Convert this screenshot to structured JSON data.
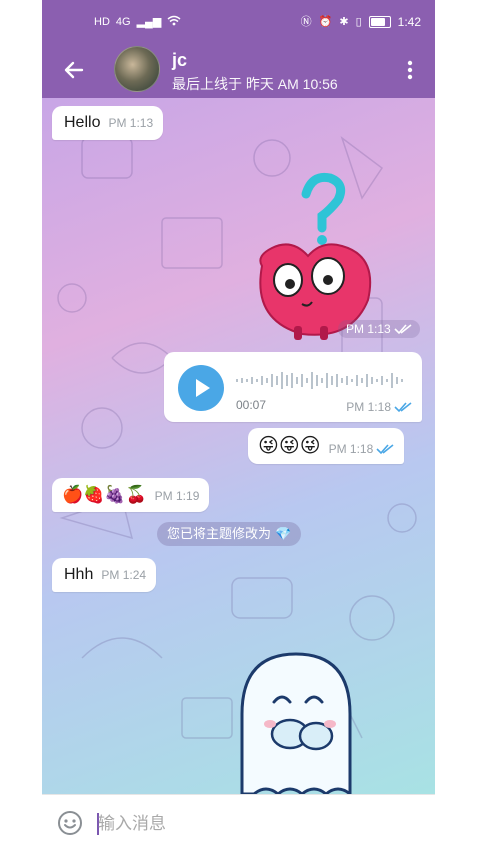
{
  "status_bar": {
    "left_icons": [
      "HD",
      "4G"
    ],
    "time": "1:42"
  },
  "header": {
    "name": "jc",
    "last_seen": "最后上线于 昨天 AM 10:56"
  },
  "messages": [
    {
      "dir": "in",
      "type": "text",
      "text": "Hello",
      "time": "PM 1:13"
    },
    {
      "dir": "out",
      "type": "sticker",
      "time": "PM 1:13"
    },
    {
      "dir": "out",
      "type": "voice",
      "duration": "00:07",
      "time": "PM 1:18"
    },
    {
      "dir": "out",
      "type": "text",
      "text": "😜😜😜",
      "time": "PM 1:18"
    },
    {
      "dir": "in",
      "type": "text",
      "text": "🍎🍓🍇🍒",
      "time": "PM 1:19"
    },
    {
      "dir": "service",
      "type": "service",
      "text": "您已将主题修改为",
      "emoji": "💎"
    },
    {
      "dir": "in",
      "type": "text",
      "text": "Hhh",
      "time": "PM 1:24"
    },
    {
      "dir": "out",
      "type": "sticker"
    }
  ],
  "input": {
    "placeholder": "输入消息"
  },
  "colors": {
    "header": "#8b5fb0",
    "voice_button": "#4aa7e6",
    "read_check": "#4aa7e6"
  },
  "icons": [
    "back-arrow-icon",
    "more-vert-icon",
    "play-icon",
    "double-check-icon",
    "smiley-icon",
    "sticker-question-cherry",
    "sticker-ghost"
  ]
}
